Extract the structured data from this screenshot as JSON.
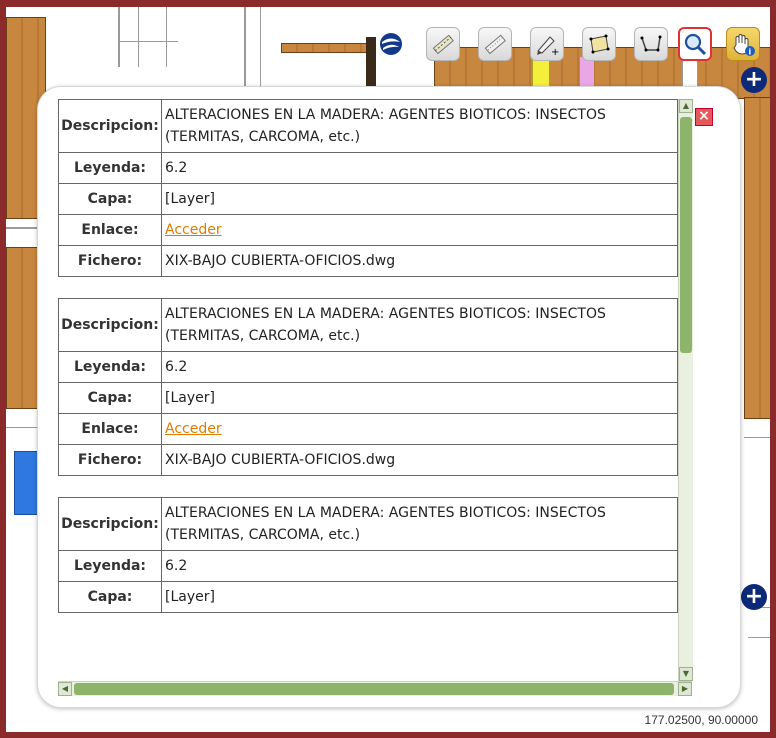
{
  "toolbar": {
    "tools": [
      {
        "name": "globe-tool",
        "icon": "globe-icon"
      },
      {
        "name": "measure-line-tool",
        "icon": "measure-ruler-icon"
      },
      {
        "name": "measure-distance-tool",
        "icon": "ruler-icon"
      },
      {
        "name": "draw-add-tool",
        "icon": "pencil-plus-icon"
      },
      {
        "name": "polygon-tool",
        "icon": "polygon-icon"
      },
      {
        "name": "polyline-tool",
        "icon": "polyline-icon"
      },
      {
        "name": "identify-tool",
        "icon": "magnifier-icon",
        "active": true
      },
      {
        "name": "pan-info-tool",
        "icon": "hand-info-icon"
      }
    ]
  },
  "popup": {
    "close_label": "×",
    "records": [
      {
        "descripcion_label": "Descripcion:",
        "descripcion": "ALTERACIONES EN LA MADERA: AGENTES BIOTICOS: INSECTOS (TERMITAS, CARCOMA, etc.)",
        "leyenda_label": "Leyenda:",
        "leyenda": "6.2",
        "capa_label": "Capa:",
        "capa": "[Layer]",
        "enlace_label": "Enlace:",
        "enlace": "Acceder",
        "fichero_label": "Fichero:",
        "fichero": "XIX-BAJO CUBIERTA-OFICIOS.dwg"
      },
      {
        "descripcion_label": "Descripcion:",
        "descripcion": "ALTERACIONES EN LA MADERA: AGENTES BIOTICOS: INSECTOS (TERMITAS, CARCOMA, etc.)",
        "leyenda_label": "Leyenda:",
        "leyenda": "6.2",
        "capa_label": "Capa:",
        "capa": "[Layer]",
        "enlace_label": "Enlace:",
        "enlace": "Acceder",
        "fichero_label": "Fichero:",
        "fichero": "XIX-BAJO CUBIERTA-OFICIOS.dwg"
      },
      {
        "descripcion_label": "Descripcion:",
        "descripcion": "ALTERACIONES EN LA MADERA: AGENTES BIOTICOS: INSECTOS (TERMITAS, CARCOMA, etc.)",
        "leyenda_label": "Leyenda:",
        "leyenda": "6.2",
        "capa_label": "Capa:",
        "capa": "[Layer]"
      }
    ]
  },
  "status": {
    "coordinates": "177.02500, 90.00000"
  },
  "colors": {
    "frame": "#8b2a2a",
    "link": "#e17b00",
    "scrollbar": "#8db46a",
    "wood": "#c8873f",
    "plus_button": "#0d2a78"
  }
}
